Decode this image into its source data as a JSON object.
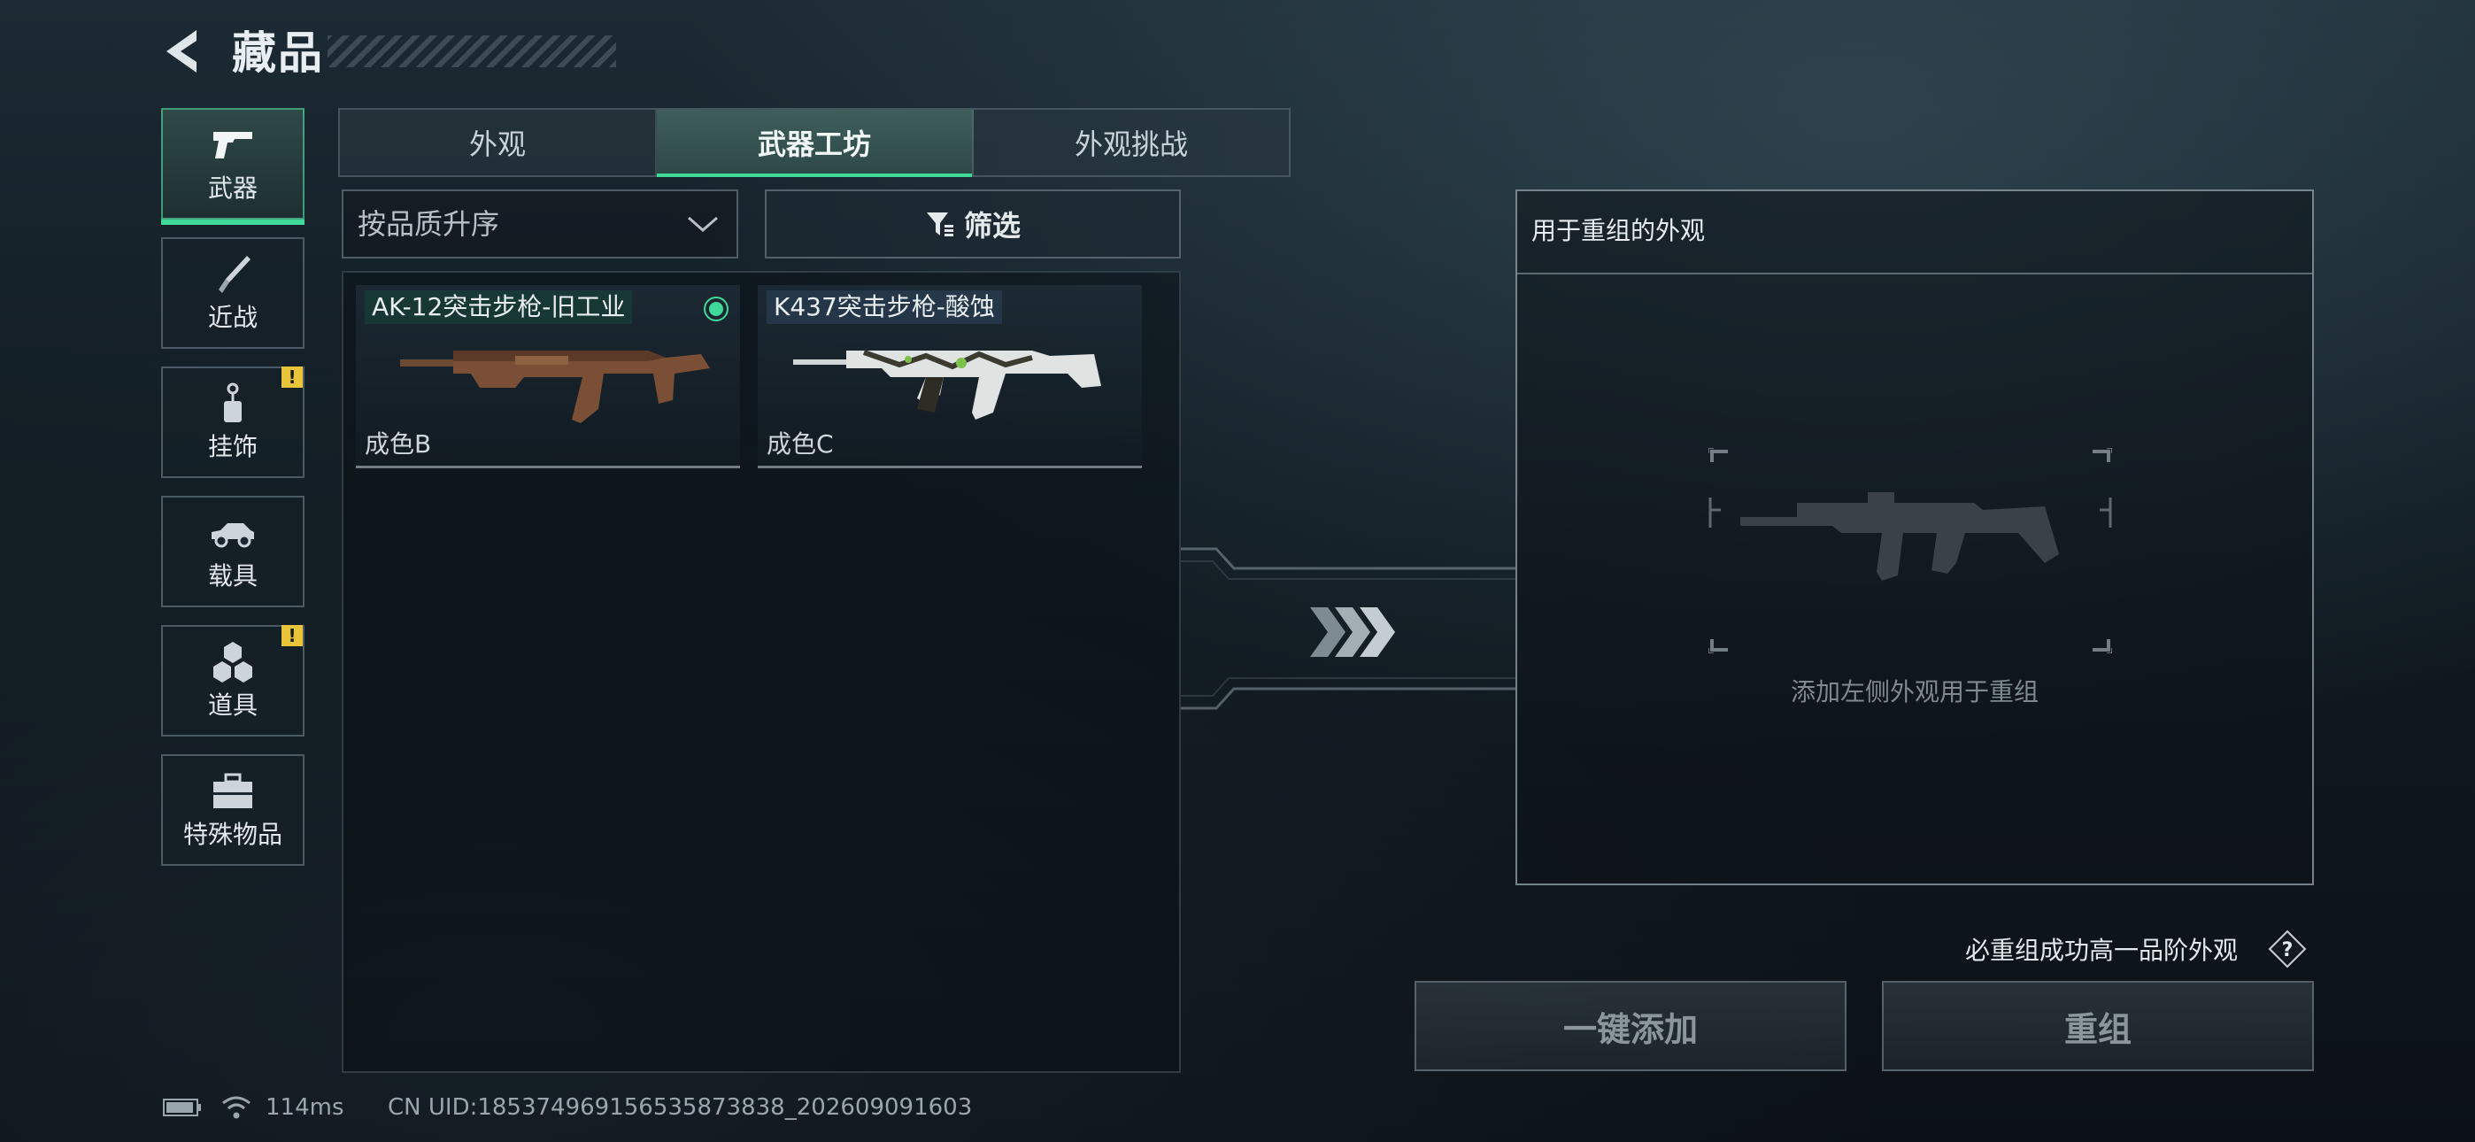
{
  "header": {
    "title": "藏品"
  },
  "sidebar": {
    "items": [
      {
        "label": "武器",
        "icon": "pistol-icon",
        "active": true,
        "warning": false
      },
      {
        "label": "近战",
        "icon": "knife-icon",
        "active": false,
        "warning": false
      },
      {
        "label": "挂饰",
        "icon": "charm-icon",
        "active": false,
        "warning": true
      },
      {
        "label": "载具",
        "icon": "vehicle-icon",
        "active": false,
        "warning": false
      },
      {
        "label": "道具",
        "icon": "items-icon",
        "active": false,
        "warning": true
      },
      {
        "label": "特殊物品",
        "icon": "toolbox-icon",
        "active": false,
        "warning": false
      }
    ],
    "warning_glyph": "!"
  },
  "tabs": [
    {
      "label": "外观",
      "active": false
    },
    {
      "label": "武器工坊",
      "active": true
    },
    {
      "label": "外观挑战",
      "active": false
    }
  ],
  "sort": {
    "value": "按品质升序"
  },
  "filter": {
    "label": "筛选"
  },
  "cards": [
    {
      "name": "AK-12突击步枪-旧工业",
      "grade": "成色B",
      "equipped": true
    },
    {
      "name": "K437突击步枪-酸蚀",
      "grade": "成色C",
      "equipped": false
    }
  ],
  "recompose": {
    "title": "用于重组的外观",
    "hint": "添加左侧外观用于重组",
    "guarantee": "必重组成功高一品阶外观",
    "help_glyph": "?",
    "add_all_label": "一键添加",
    "recompose_label": "重组"
  },
  "status": {
    "ping": "114ms",
    "uid": "CN UID:185374969156535873838_202609091603"
  },
  "colors": {
    "accent": "#3fd99a",
    "warning": "#e8c43a"
  }
}
